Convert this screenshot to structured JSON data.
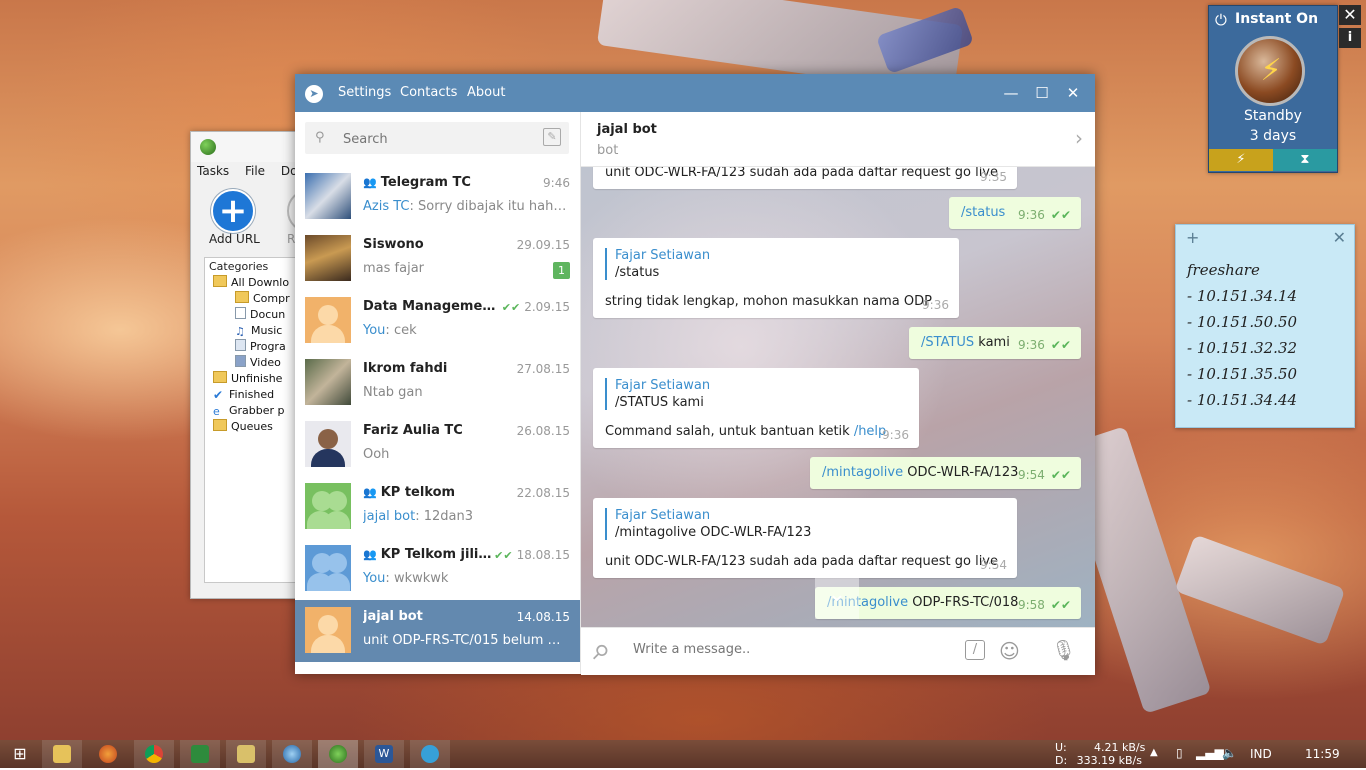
{
  "idm": {
    "menu": [
      "Tasks",
      "File",
      "Do"
    ],
    "toolbar": {
      "add_url": "Add URL",
      "resume": "Re"
    },
    "categories_label": "Categories",
    "tree": [
      {
        "label": "All Downlo",
        "icon": "folder-icon"
      },
      {
        "label": "Compr",
        "icon": "folder-icon"
      },
      {
        "label": "Docun",
        "icon": "document-icon"
      },
      {
        "label": "Music",
        "icon": "music-icon"
      },
      {
        "label": "Progra",
        "icon": "program-icon"
      },
      {
        "label": "Video",
        "icon": "video-icon"
      },
      {
        "label": "Unfinishe",
        "icon": "folder-icon"
      },
      {
        "label": "Finished",
        "icon": "check-icon"
      },
      {
        "label": "Grabber p",
        "icon": "ie-icon"
      },
      {
        "label": "Queues",
        "icon": "folder-icon"
      }
    ]
  },
  "telegram": {
    "menu": {
      "settings": "Settings",
      "contacts": "Contacts",
      "about": "About"
    },
    "search_placeholder": "Search",
    "chats": [
      {
        "name": "Telegram TC",
        "group": true,
        "date": "9:46",
        "sender": "Azis TC",
        "preview": "Sorry dibajak itu hahaha",
        "avatar": "photo-banner"
      },
      {
        "name": "Siswono",
        "group": false,
        "date": "29.09.15",
        "sender": "",
        "preview": "mas fajar",
        "unread": "1",
        "avatar": "photo-group"
      },
      {
        "name": "Data Management S...",
        "group": false,
        "date": "2.09.15",
        "ticks": true,
        "sender": "You",
        "preview": "cek",
        "avatar": "placeholder-orange"
      },
      {
        "name": "Ikrom fahdi",
        "group": false,
        "date": "27.08.15",
        "sender": "",
        "preview": "Ntab gan",
        "avatar": "photo-people"
      },
      {
        "name": "Fariz Aulia TC",
        "group": false,
        "date": "26.08.15",
        "sender": "",
        "preview": "Ooh",
        "avatar": "photo-portrait"
      },
      {
        "name": "KP telkom",
        "group": true,
        "date": "22.08.15",
        "sender": "jajal bot",
        "preview": "12dan3",
        "avatar": "placeholder-green"
      },
      {
        "name": "KP Telkom jilid 2",
        "group": true,
        "date": "18.08.15",
        "ticks": true,
        "sender": "You",
        "preview": "wkwkwk",
        "avatar": "placeholder-blue"
      },
      {
        "name": "jajal bot",
        "group": false,
        "date": "14.08.15",
        "sender": "",
        "preview": "unit ODP-FRS-TC/015 belum go li...",
        "active": true,
        "avatar": "placeholder-orange"
      }
    ],
    "peer": {
      "name": "jajal bot",
      "status": "bot"
    },
    "messages": [
      {
        "dir": "in",
        "text": "unit ODC-WLR-FA/123 sudah ada pada daftar request go live",
        "time": "9:35"
      },
      {
        "dir": "out",
        "cmd": "/status",
        "text": "",
        "time": "9:36"
      },
      {
        "dir": "in",
        "reply_name": "Fajar Setiawan",
        "reply_text": "/status",
        "text": "string tidak lengkap, mohon masukkan nama ODP",
        "time": "9:36"
      },
      {
        "dir": "out",
        "cmd": "/STATUS",
        "text": " kami",
        "time": "9:36"
      },
      {
        "dir": "in",
        "reply_name": "Fajar Setiawan",
        "reply_text": "/STATUS kami",
        "text": "Command salah, untuk bantuan ketik ",
        "cmd_tail": "/help",
        "time": "9:36"
      },
      {
        "dir": "out",
        "cmd": "/mintagolive",
        "text": " ODC-WLR-FA/123",
        "time": "9:54"
      },
      {
        "dir": "in",
        "reply_name": "Fajar Setiawan",
        "reply_text": "/mintagolive ODC-WLR-FA/123",
        "text": "unit ODC-WLR-FA/123 sudah ada pada daftar request go live",
        "time": "9:54"
      },
      {
        "dir": "out",
        "cmd": "/mintagolive",
        "text": " ODP-FRS-TC/018",
        "time": "9:58"
      }
    ],
    "composer_placeholder": "Write a message.."
  },
  "instant_on": {
    "title": "Instant On",
    "status": "Standby",
    "duration": "3 days"
  },
  "sticky_note": {
    "lines": [
      "freeshare",
      "- 10.151.34.14",
      "- 10.151.50.50",
      "- 10.151.32.32",
      "- 10.151.35.50",
      "- 10.151.34.44"
    ]
  },
  "taskbar": {
    "apps": [
      "start",
      "file-explorer",
      "firefox",
      "chrome",
      "excel-like",
      "explorer-folder",
      "globe",
      "idm",
      "word",
      "telegram"
    ],
    "net_up_label": "U:",
    "net_up": "4.21 kB/s",
    "net_down_label": "D:",
    "net_down": "333.19 kB/s",
    "language": "IND",
    "clock": "11:59"
  },
  "colors": {
    "telegram_header": "#5b8ab5",
    "active_chat": "#6389af",
    "link": "#3a8ecd",
    "out_bubble": "#effdde"
  }
}
